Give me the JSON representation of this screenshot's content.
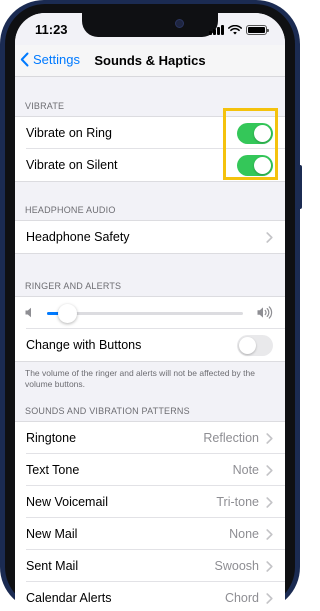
{
  "status_bar": {
    "time": "11:23",
    "battery_level": 1.0
  },
  "nav": {
    "back_label": "Settings",
    "title": "Sounds & Haptics"
  },
  "vibrate": {
    "header": "VIBRATE",
    "rows": [
      {
        "label": "Vibrate on Ring",
        "on": true
      },
      {
        "label": "Vibrate on Silent",
        "on": true
      }
    ]
  },
  "headphone": {
    "header": "HEADPHONE AUDIO",
    "rows": [
      {
        "label": "Headphone Safety"
      }
    ]
  },
  "ringer": {
    "header": "RINGER AND ALERTS",
    "volume_level": 0.1,
    "change_with_buttons": {
      "label": "Change with Buttons",
      "on": false
    },
    "footnote": "The volume of the ringer and alerts will not be affected by the volume buttons."
  },
  "patterns": {
    "header": "SOUNDS AND VIBRATION PATTERNS",
    "rows": [
      {
        "label": "Ringtone",
        "value": "Reflection"
      },
      {
        "label": "Text Tone",
        "value": "Note"
      },
      {
        "label": "New Voicemail",
        "value": "Tri-tone"
      },
      {
        "label": "New Mail",
        "value": "None"
      },
      {
        "label": "Sent Mail",
        "value": "Swoosh"
      },
      {
        "label": "Calendar Alerts",
        "value": "Chord"
      }
    ]
  },
  "colors": {
    "accent": "#007aff",
    "toggle_on": "#34c759",
    "highlight": "#f4c20d",
    "phone_frame": "#1b2b52"
  }
}
